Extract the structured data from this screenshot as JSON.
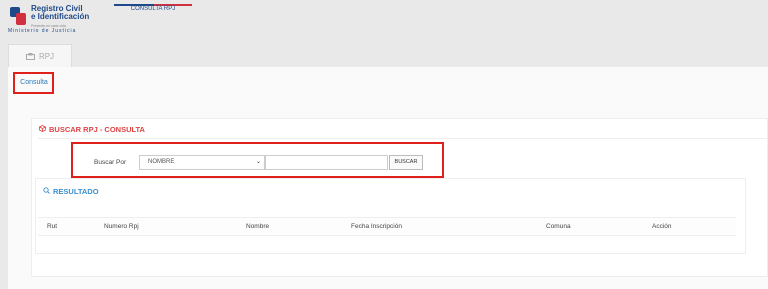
{
  "header": {
    "logo_line1": "Registro Civil",
    "logo_line2": "e Identificación",
    "logo_sub": "Presente en cada vida",
    "ministry": "Ministerio de Justicia",
    "nav_link": "CONSULTA RPJ"
  },
  "tab": {
    "label": "RPJ"
  },
  "menu": {
    "consulta": "Consulta"
  },
  "search_panel": {
    "title": "BUSCAR RPJ - CONSULTA",
    "label": "Buscar Por",
    "select_value": "NOMBRE",
    "input_value": "",
    "button": "BUSCAR"
  },
  "results": {
    "title": "RESULTADO",
    "columns": [
      "Rut",
      "Numero Rpj",
      "Nombre",
      "Fecha Inscripción",
      "Comuna",
      "Acción"
    ]
  },
  "colors": {
    "brand_blue": "#1f4a8a",
    "brand_red": "#d1313f",
    "highlight": "#e0201a",
    "title_red": "#d44",
    "title_blue": "#3a8fcf"
  }
}
